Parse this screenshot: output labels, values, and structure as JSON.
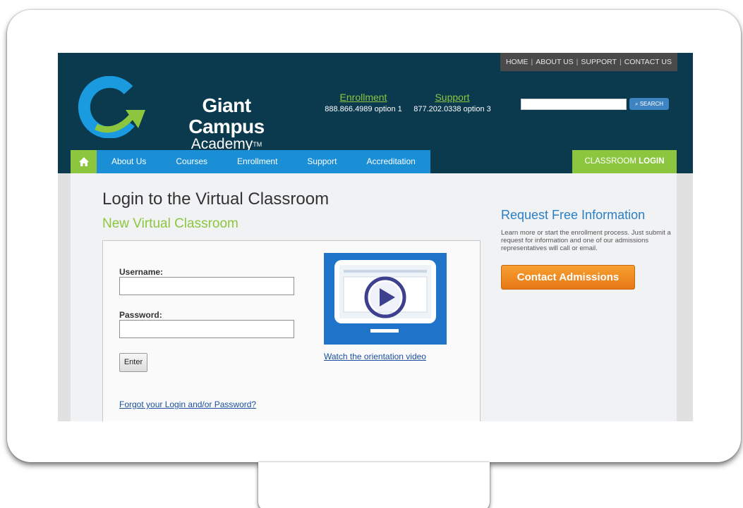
{
  "topnav": {
    "home": "HOME",
    "about": "ABOUT US",
    "support": "SUPPORT",
    "contact": "CONTACT US",
    "separator": "|"
  },
  "logo": {
    "line1": "Giant Campus",
    "line2": "Academy",
    "tm": "TM"
  },
  "contacts": {
    "enrollment_title": "Enrollment",
    "enrollment_number": "888.866.4989 option 1",
    "support_title": "Support",
    "support_number": "877.202.0338 option 3"
  },
  "search": {
    "button_label": "SEARCH",
    "value": ""
  },
  "nav": {
    "items": [
      {
        "label": "About Us"
      },
      {
        "label": "Courses"
      },
      {
        "label": "Enrollment"
      },
      {
        "label": "Support"
      },
      {
        "label": "Accreditation"
      }
    ],
    "classroom_prefix": "CLASSROOM",
    "classroom_bold": "LOGIN"
  },
  "page": {
    "title": "Login to the Virtual Classroom",
    "subtitle": "New Virtual Classroom"
  },
  "login": {
    "username_label": "Username:",
    "username_value": "",
    "password_label": "Password:",
    "password_value": "",
    "enter_label": "Enter",
    "forgot_link": "Forgot your Login and/or Password?",
    "video_link": "Watch the orientation video"
  },
  "sidebar": {
    "title": "Request Free Information",
    "text": "Learn more or start the enrollment process. Just submit a request for information and one of our admissions representatives will call or email.",
    "button_label": "Contact Admissions"
  },
  "colors": {
    "header_bg": "#0b3a4f",
    "nav_blue": "#1a8fd6",
    "accent_green": "#8cc63f",
    "link_blue": "#1c4fa0",
    "orange_button": "#f08a22"
  },
  "icons": {
    "home": "home-icon",
    "search": "search-icon",
    "play": "play-icon",
    "logo": "logo-mark"
  }
}
